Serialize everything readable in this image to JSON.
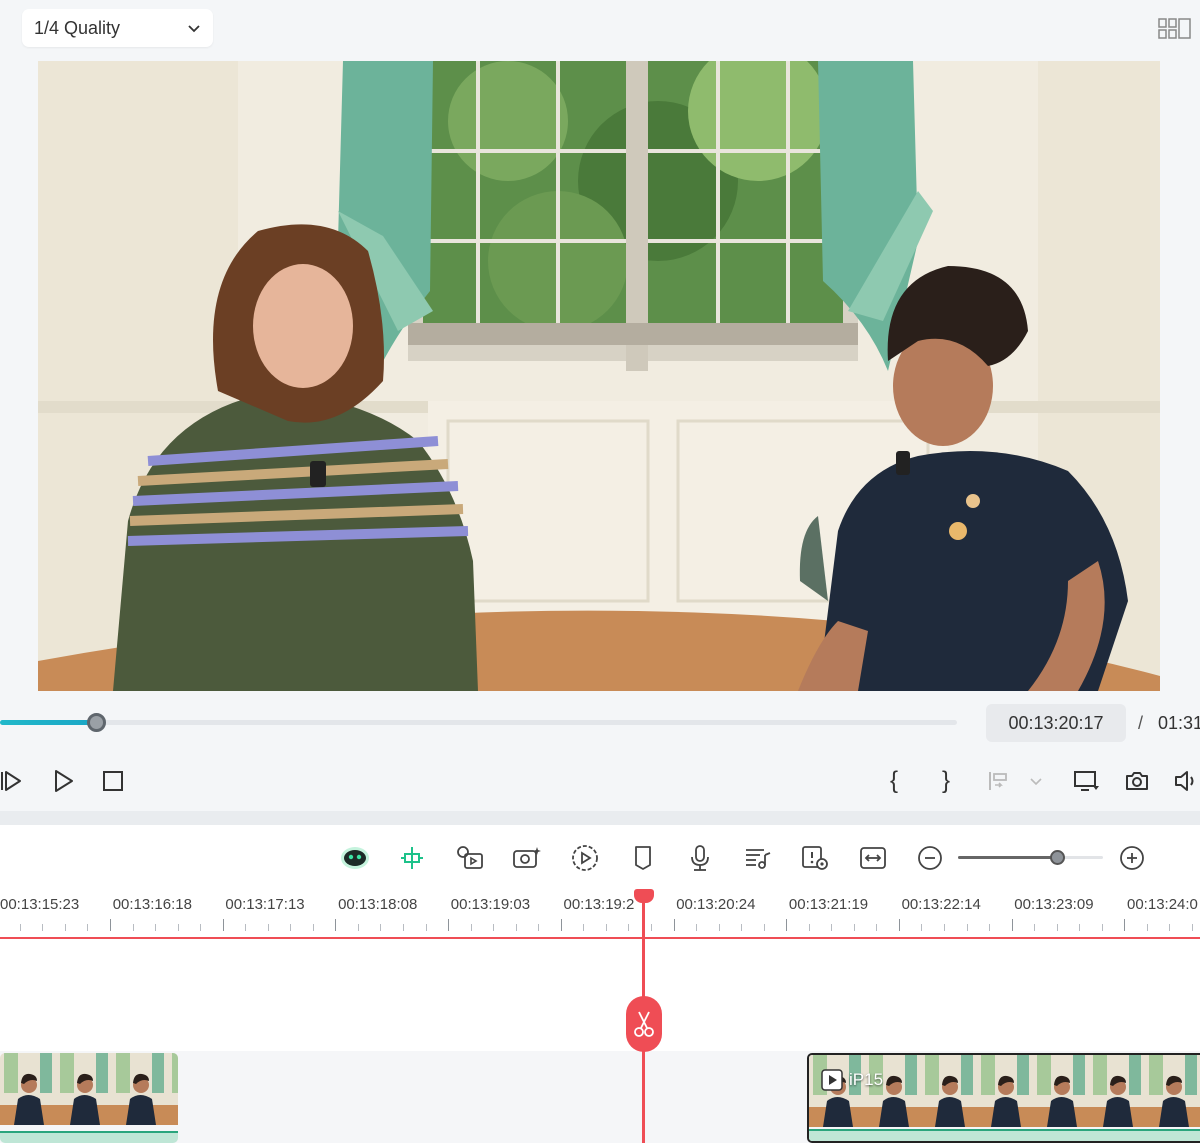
{
  "topbar": {
    "quality_label": "1/4 Quality",
    "layout_icon": "grid-layout-icon"
  },
  "player": {
    "progress_fraction": 0.1,
    "current_time": "00:13:20:17",
    "separator": "/",
    "total_time": "01:31"
  },
  "playback_controls": [
    {
      "name": "play-next-frame-icon"
    },
    {
      "name": "play-icon"
    },
    {
      "name": "stop-icon"
    }
  ],
  "right_controls": [
    {
      "name": "mark-in-icon",
      "glyph": "{"
    },
    {
      "name": "mark-out-icon",
      "glyph": "}"
    },
    {
      "name": "insert-clip-icon"
    },
    {
      "name": "chevron-down-icon"
    },
    {
      "name": "display-settings-icon"
    },
    {
      "name": "snapshot-camera-icon"
    },
    {
      "name": "volume-icon"
    }
  ],
  "timeline_toolbar": {
    "tools": [
      "ai-copilot-icon",
      "auto-reframe-icon",
      "text-to-speech-icon",
      "ai-video-icon",
      "speed-icon",
      "marker-icon",
      "record-voiceover-icon",
      "audio-stretch-icon",
      "preview-render-icon",
      "fit-timeline-icon",
      "zoom-out-icon",
      "zoom-in-icon"
    ],
    "zoom_level": 0.68
  },
  "ruler": {
    "labels": [
      "00:13:15:23",
      "00:13:16:18",
      "00:13:17:13",
      "00:13:18:08",
      "00:13:19:03",
      "00:13:19:2",
      "00:13:20:24",
      "00:13:21:19",
      "00:13:22:14",
      "00:13:23:09",
      "00:13:24:0"
    ]
  },
  "clips": {
    "right_clip_name": "iP15"
  },
  "colors": {
    "accent": "#1aa6c6",
    "playhead": "#ef4d55",
    "audio_wave": "#2aa57d"
  }
}
